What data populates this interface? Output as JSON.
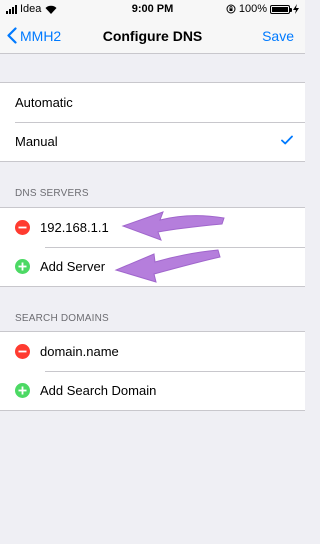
{
  "status_bar": {
    "carrier": "Idea",
    "time": "9:00 PM",
    "battery_percent": "100%",
    "battery_level": 1.0
  },
  "nav": {
    "back_label": "MMH2",
    "title": "Configure DNS",
    "save_label": "Save"
  },
  "mode": {
    "options": [
      "Automatic",
      "Manual"
    ],
    "selected": "Manual"
  },
  "dns_servers": {
    "header": "DNS SERVERS",
    "servers": [
      "192.168.1.1"
    ],
    "add_label": "Add Server"
  },
  "search_domains": {
    "header": "SEARCH DOMAINS",
    "domains": [
      "domain.name"
    ],
    "add_label": "Add Search Domain"
  },
  "colors": {
    "accent": "#007aff",
    "delete": "#ff3b30",
    "add": "#4cd964",
    "arrow": "#b57edc"
  },
  "icons": [
    "signal-icon",
    "wifi-icon",
    "orientation-lock-icon",
    "battery-icon",
    "charging-icon",
    "chevron-left-icon",
    "checkmark-icon",
    "delete-circle-icon",
    "add-circle-icon",
    "arrow-annotation-icon"
  ]
}
